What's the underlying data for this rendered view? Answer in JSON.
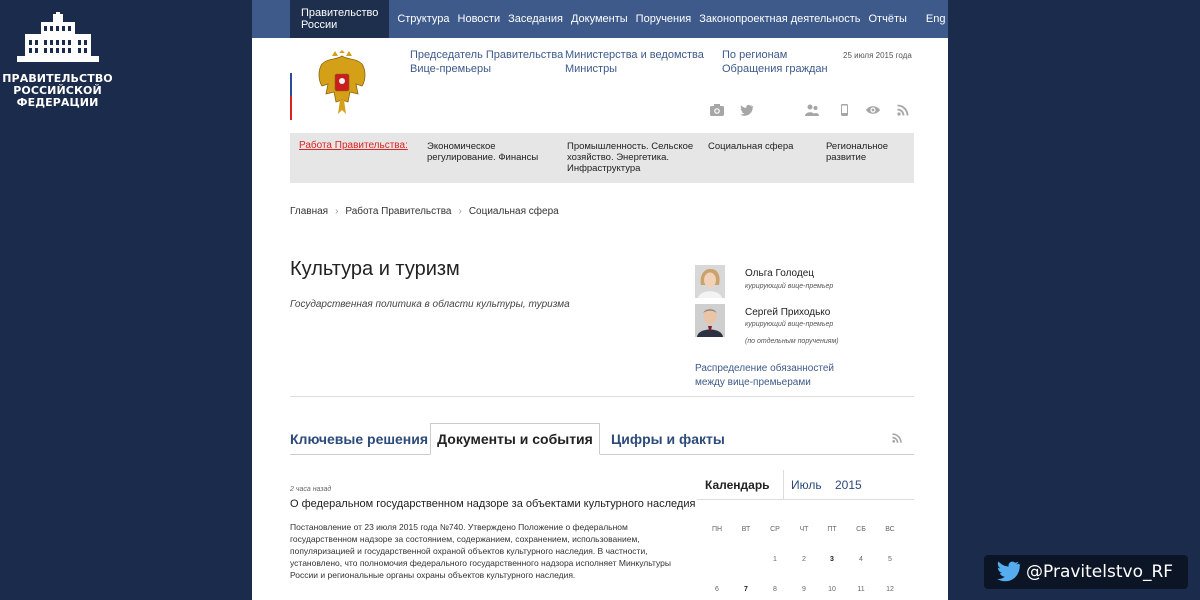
{
  "brand": {
    "lines": [
      "ПРАВИТЕЛЬСТВО",
      "РОССИЙСКОЙ",
      "ФЕДЕРАЦИИ"
    ]
  },
  "topnav": {
    "home": "Правительство России",
    "items": [
      "Структура",
      "Новости",
      "Заседания",
      "Документы",
      "Поручения",
      "Законопроектная деятельность",
      "Отчёты"
    ],
    "lang": "Eng",
    "icons": {
      "search": "search-icon"
    }
  },
  "header": {
    "links": [
      [
        "Председатель Правительства",
        "Вице-премьеры"
      ],
      [
        "Министерства и ведомства",
        "Министры"
      ],
      [
        "По регионам",
        "Обращения граждан"
      ]
    ],
    "date": "25 июля 2015 года",
    "social_icons": [
      "camera-icon",
      "twitter-icon",
      "users-icon",
      "mobile-icon",
      "eye-icon",
      "rss-icon"
    ]
  },
  "workbar": {
    "title": "Работа Правительства:",
    "items": [
      "Экономическое регулирование. Финансы",
      "Промышленность. Сельское хозяйство. Энергетика. Инфраструктура",
      "Социальная сфера",
      "Региональное развитие"
    ]
  },
  "breadcrumb": [
    "Главная",
    "Работа Правительства",
    "Социальная сфера"
  ],
  "page": {
    "title": "Культура и туризм",
    "subtitle": "Государственная политика в области культуры, туризма"
  },
  "curators": [
    {
      "name": "Ольга Голодец",
      "role": "курирующий вице-премьер",
      "note": ""
    },
    {
      "name": "Сергей Приходько",
      "role": "курирующий вице-премьер",
      "note": "(по отдельным поручениям)"
    }
  ],
  "duties_link": [
    "Распределение обязанностей",
    "между вице-премьерами"
  ],
  "tabs": {
    "key": "Ключевые решения",
    "docs": "Документы и события",
    "facts": "Цифры и факты"
  },
  "news": {
    "time": "2 часа назад",
    "title": "О федеральном государственном надзоре за объектами культурного наследия",
    "body": "Постановление от 23 июля 2015 года №740. Утверждено Положение о федеральном государственном надзоре за состоянием, содержанием, сохранением, использованием, популяризацией и государственной охраной объектов культурного наследия. В частности, установлено, что полномочия федерального государственного надзора исполняет Минкультуры России и региональные органы охраны объектов культурного наследия."
  },
  "calendar": {
    "label": "Календарь",
    "month": "Июль",
    "year": "2015",
    "weekdays": [
      "ПН",
      "ВТ",
      "СР",
      "ЧТ",
      "ПТ",
      "СБ",
      "ВС"
    ],
    "rows": [
      [
        "",
        "",
        "1",
        "2",
        "3",
        "4",
        "5"
      ],
      [
        "6",
        "7",
        "8",
        "9",
        "10",
        "11",
        "12"
      ]
    ],
    "bold_days": [
      "3",
      "7"
    ]
  },
  "twitter": {
    "handle": "@Pravitelstvo_RF"
  }
}
